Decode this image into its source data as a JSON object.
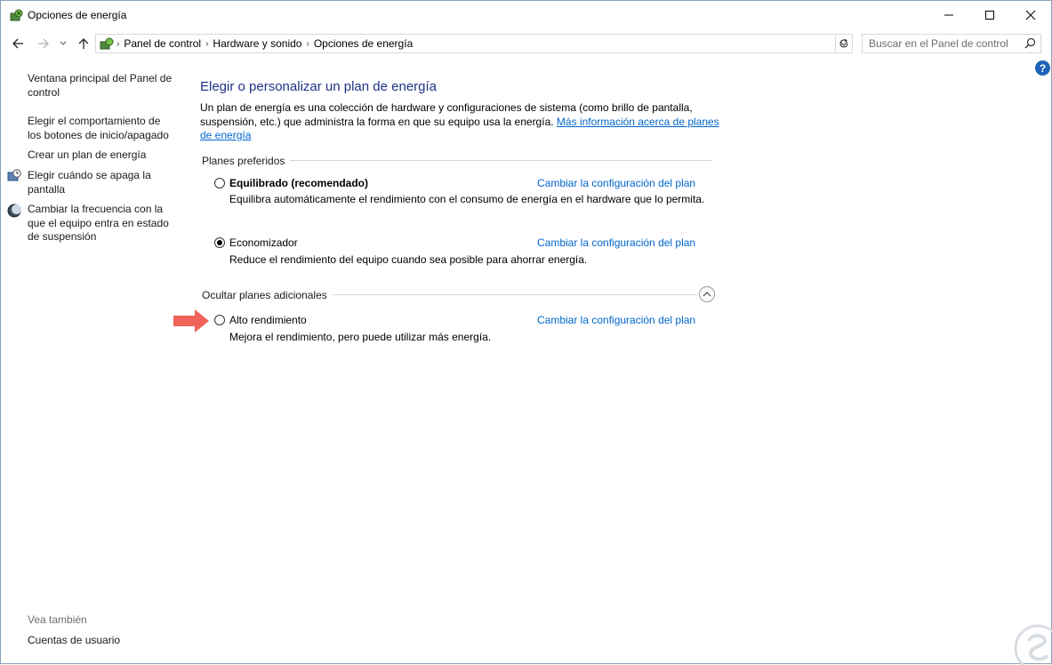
{
  "window": {
    "title": "Opciones de energía"
  },
  "address": {
    "breadcrumbs": [
      "Panel de control",
      "Hardware y sonido",
      "Opciones de energía"
    ],
    "search_placeholder": "Buscar en el Panel de control"
  },
  "sidebar": {
    "items": [
      {
        "label": "Ventana principal del Panel de control"
      },
      {
        "label": "Elegir el comportamiento de los botones de inicio/apagado"
      },
      {
        "label": "Crear un plan de energía"
      },
      {
        "label": "Elegir cuándo se apaga la pantalla"
      },
      {
        "label": "Cambiar la frecuencia con la que el equipo entra en estado de suspensión"
      }
    ],
    "see_also": "Vea también",
    "see_also_links": [
      "Cuentas de usuario"
    ]
  },
  "main": {
    "heading": "Elegir o personalizar un plan de energía",
    "intro_text": "Un plan de energía es una colección de hardware y configuraciones de sistema (como brillo de pantalla, suspensión, etc.) que administra la forma en que su equipo usa la energía.",
    "intro_link": "Más información acerca de planes de energía",
    "preferred_label": "Planes preferidos",
    "additional_label": "Ocultar planes adicionales",
    "change_link": "Cambiar la configuración del plan",
    "plans": [
      {
        "name": "Equilibrado (recomendado)",
        "description": "Equilibra automáticamente el rendimiento con el consumo de energía en el hardware que lo permita.",
        "selected": false
      },
      {
        "name": "Economizador",
        "description": "Reduce el rendimiento del equipo cuando sea posible para ahorrar energía.",
        "selected": true
      },
      {
        "name": "Alto rendimiento",
        "description": "Mejora el rendimiento, pero puede utilizar más energía.",
        "selected": false
      }
    ]
  },
  "colors": {
    "heading": "#1e3287",
    "link": "#0066cc",
    "arrow": "#f0645a",
    "help": "#1e63b8"
  }
}
